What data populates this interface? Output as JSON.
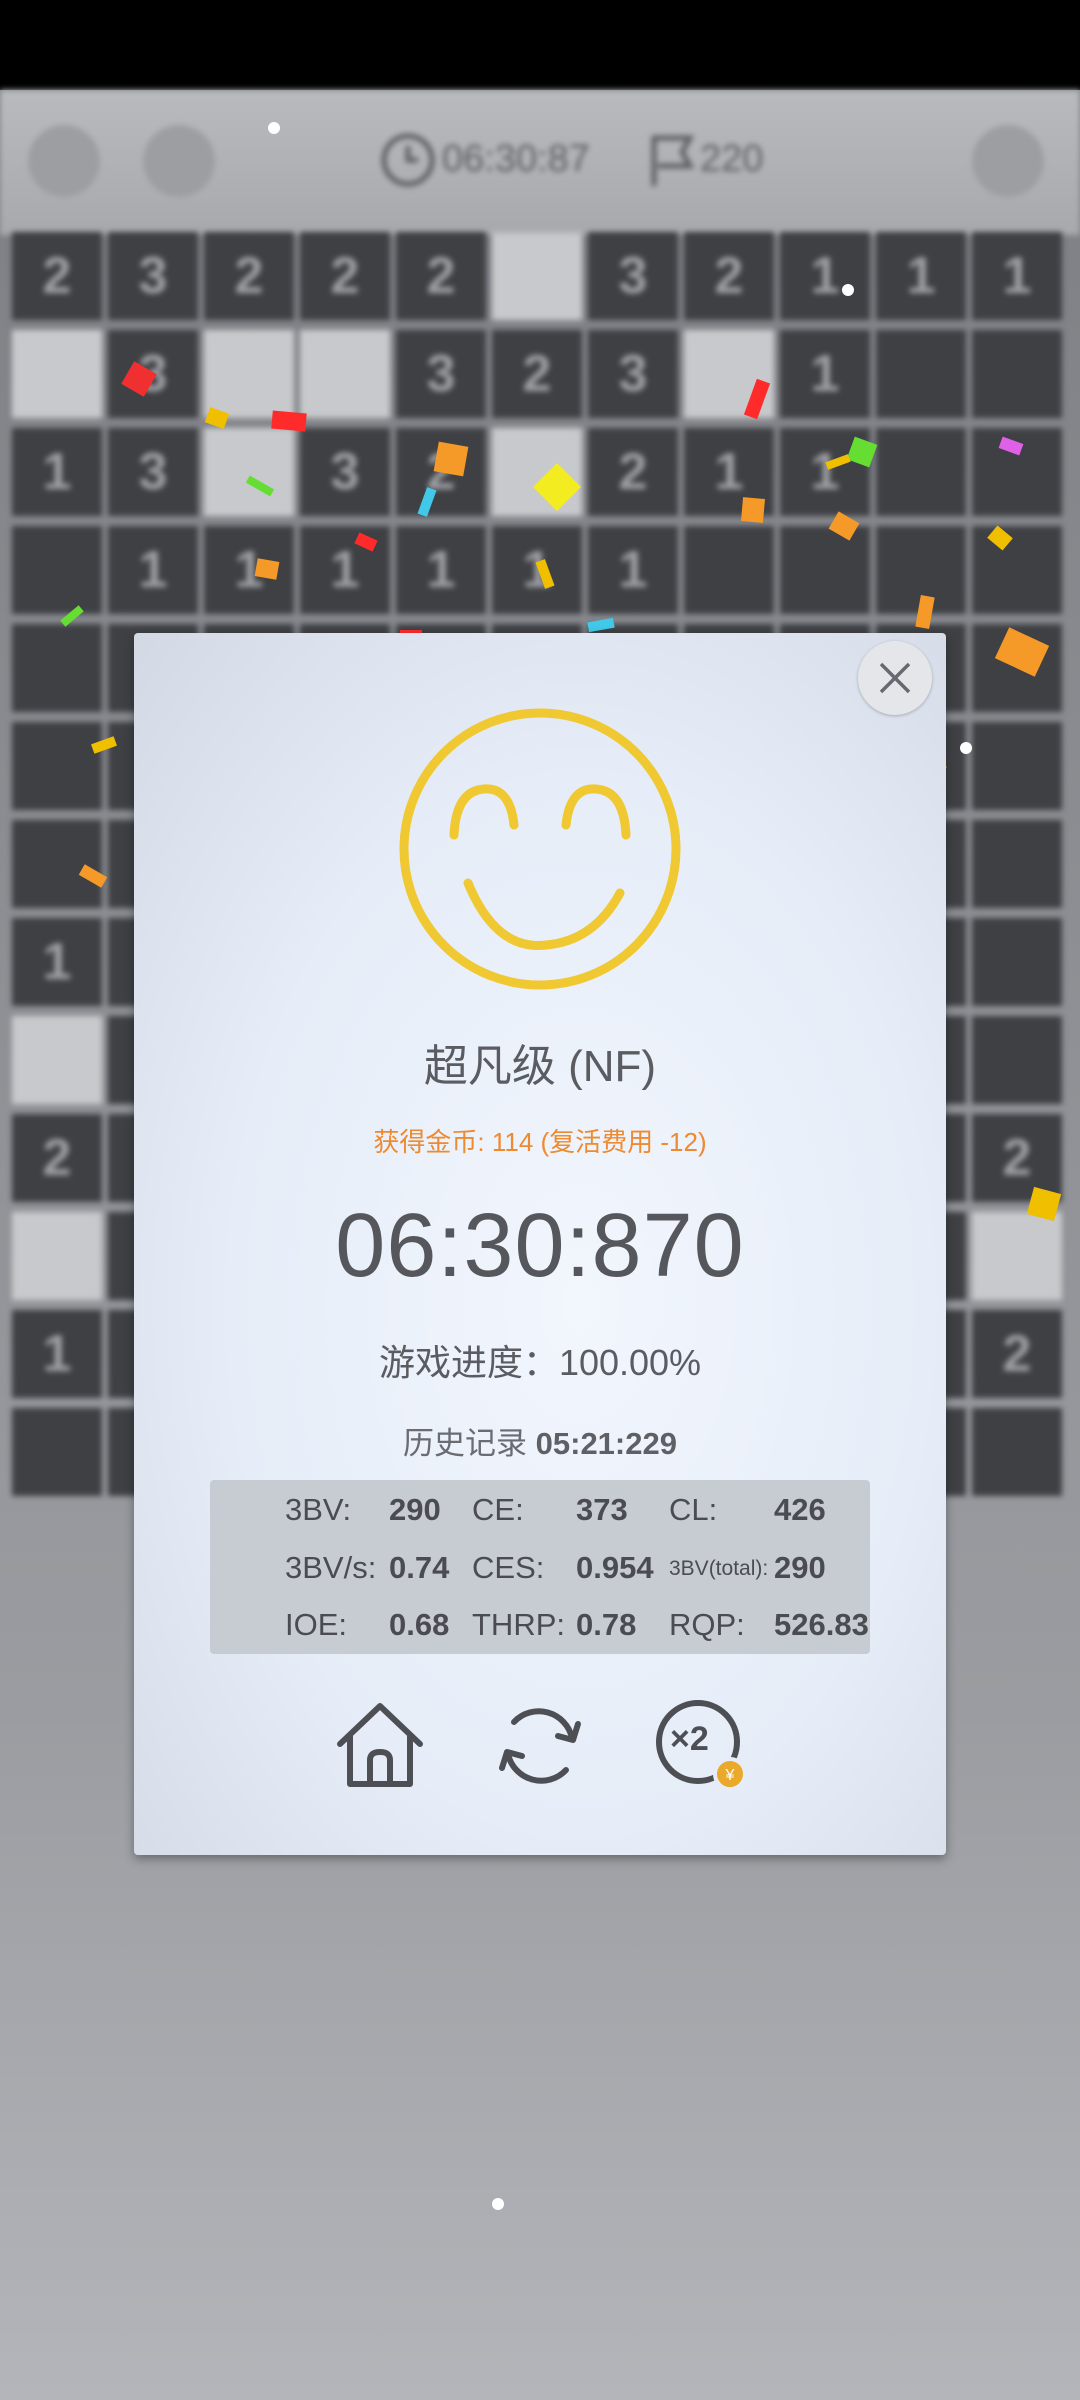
{
  "topbar": {
    "timer": "06:30:87",
    "flags": "220"
  },
  "board": {
    "rows": [
      [
        "2",
        "3",
        "2",
        "2",
        "2",
        "",
        "3",
        "2",
        "1",
        "1",
        "1"
      ],
      [
        "",
        "3",
        "",
        "",
        "3",
        "2",
        "3",
        "",
        "1",
        "",
        ""
      ],
      [
        "1",
        "3",
        "",
        "3",
        "2",
        "",
        "2",
        "1",
        "1",
        "",
        ""
      ],
      [
        "",
        "1",
        "1",
        "1",
        "1",
        "1",
        "1",
        "",
        "",
        "",
        ""
      ],
      [
        "",
        "",
        "",
        "",
        "",
        "",
        "",
        "",
        "",
        "",
        ""
      ],
      [
        "",
        "",
        "",
        "",
        "",
        "",
        "",
        "",
        "",
        "",
        ""
      ],
      [
        "",
        "",
        "",
        "",
        "",
        "",
        "",
        "",
        "",
        "",
        ""
      ],
      [
        "1",
        "",
        "",
        "",
        "",
        "",
        "",
        "",
        "",
        "",
        ""
      ],
      [
        "",
        "",
        "",
        "",
        "",
        "",
        "",
        "",
        "",
        "",
        ""
      ],
      [
        "2",
        "",
        "",
        "",
        "",
        "",
        "",
        "",
        "",
        "",
        "2"
      ],
      [
        "",
        "",
        "",
        "",
        "",
        "",
        "",
        "",
        "",
        "",
        ""
      ],
      [
        "1",
        "",
        "",
        "",
        "",
        "",
        "",
        "",
        "",
        "",
        "2"
      ],
      [
        "",
        "",
        "",
        "",
        "",
        "",
        "",
        "",
        "",
        "",
        ""
      ]
    ],
    "open_cells": [
      [
        1,
        0
      ],
      [
        1,
        2
      ],
      [
        1,
        3
      ],
      [
        1,
        7
      ],
      [
        2,
        2
      ],
      [
        2,
        5
      ],
      [
        8,
        0
      ],
      [
        10,
        0
      ],
      [
        10,
        10
      ],
      [
        0,
        5
      ]
    ]
  },
  "dialog": {
    "level": "超凡级 (NF)",
    "coins": "获得金币: 114 (复活费用 -12)",
    "time": "06:30:870",
    "progress": "游戏进度：100.00%",
    "history_label": "历史记录",
    "history_value": "05:21:229",
    "stats": {
      "bbbv_label": "3BV:",
      "bbbv": "290",
      "ce_label": "CE:",
      "ce": "373",
      "cl_label": "CL:",
      "cl": "426",
      "bbbvs_label": "3BV/s:",
      "bbbvs": "0.74",
      "ces_label": "CES:",
      "ces": "0.954",
      "bbbv_total_label": "3BV(total):",
      "bbbv_total": "290",
      "ioe_label": "IOE:",
      "ioe": "0.68",
      "thrp_label": "THRP:",
      "thrp": "0.78",
      "rqp_label": "RQP:",
      "rqp": "526.83"
    },
    "actions": {
      "home_icon": "home-icon",
      "restart_icon": "restart-icon",
      "double_icon": "double-reward-icon",
      "double_label": "×2"
    }
  },
  "colors": {
    "smiley": "#f0c832",
    "coins_text": "#ee8a2f",
    "dialog_bg": "#e9eff9"
  }
}
